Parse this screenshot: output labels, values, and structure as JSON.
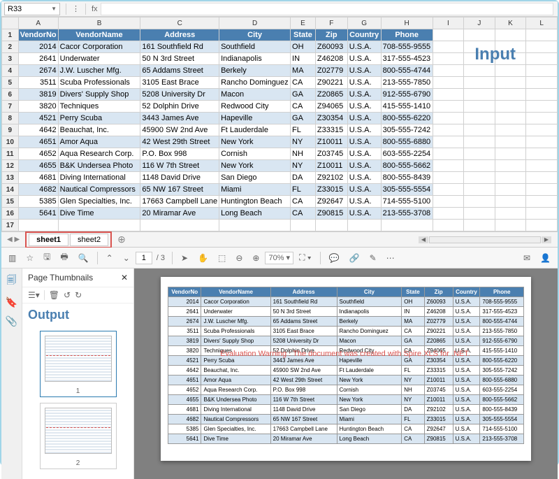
{
  "top": {
    "name_box": "R33",
    "fx_label": "fx",
    "input_label": "Input",
    "columns": [
      "A",
      "B",
      "C",
      "D",
      "E",
      "F",
      "G",
      "H",
      "I",
      "J",
      "K",
      "L"
    ],
    "headers": [
      "VendorNo",
      "VendorName",
      "Address",
      "City",
      "State",
      "Zip",
      "Country",
      "Phone"
    ],
    "rows": [
      {
        "n": "2",
        "v": [
          "2014",
          "Cacor Corporation",
          "161 Southfield Rd",
          "Southfield",
          "OH",
          "Z60093",
          "U.S.A.",
          "708-555-9555"
        ]
      },
      {
        "n": "3",
        "v": [
          "2641",
          "Underwater",
          "50 N 3rd Street",
          "Indianapolis",
          "IN",
          "Z46208",
          "U.S.A.",
          "317-555-4523"
        ]
      },
      {
        "n": "4",
        "v": [
          "2674",
          "J.W.  Luscher Mfg.",
          "65 Addams Street",
          "Berkely",
          "MA",
          "Z02779",
          "U.S.A.",
          "800-555-4744"
        ]
      },
      {
        "n": "5",
        "v": [
          "3511",
          "Scuba Professionals",
          "3105 East Brace",
          "Rancho Dominguez",
          "CA",
          "Z90221",
          "U.S.A.",
          "213-555-7850"
        ]
      },
      {
        "n": "6",
        "v": [
          "3819",
          "Divers'  Supply Shop",
          "5208 University Dr",
          "Macon",
          "GA",
          "Z20865",
          "U.S.A.",
          "912-555-6790"
        ]
      },
      {
        "n": "7",
        "v": [
          "3820",
          "Techniques",
          "52 Dolphin Drive",
          "Redwood City",
          "CA",
          "Z94065",
          "U.S.A.",
          "415-555-1410"
        ]
      },
      {
        "n": "8",
        "v": [
          "4521",
          "Perry Scuba",
          "3443 James Ave",
          "Hapeville",
          "GA",
          "Z30354",
          "U.S.A.",
          "800-555-6220"
        ]
      },
      {
        "n": "9",
        "v": [
          "4642",
          "Beauchat, Inc.",
          "45900 SW 2nd Ave",
          "Ft Lauderdale",
          "FL",
          "Z33315",
          "U.S.A.",
          "305-555-7242"
        ]
      },
      {
        "n": "10",
        "v": [
          "4651",
          "Amor Aqua",
          "42 West 29th Street",
          "New York",
          "NY",
          "Z10011",
          "U.S.A.",
          "800-555-6880"
        ]
      },
      {
        "n": "11",
        "v": [
          "4652",
          "Aqua Research Corp.",
          "P.O. Box 998",
          "Cornish",
          "NH",
          "Z03745",
          "U.S.A.",
          "603-555-2254"
        ]
      },
      {
        "n": "12",
        "v": [
          "4655",
          "B&K Undersea Photo",
          "116 W 7th Street",
          "New York",
          "NY",
          "Z10011",
          "U.S.A.",
          "800-555-5662"
        ]
      },
      {
        "n": "13",
        "v": [
          "4681",
          "Diving International",
          "1148 David Drive",
          "San Diego",
          "DA",
          "Z92102",
          "U.S.A.",
          "800-555-8439"
        ]
      },
      {
        "n": "14",
        "v": [
          "4682",
          "Nautical Compressors",
          "65 NW 167 Street",
          "Miami",
          "FL",
          "Z33015",
          "U.S.A.",
          "305-555-5554"
        ]
      },
      {
        "n": "15",
        "v": [
          "5385",
          "Glen Specialties, Inc.",
          "17663 Campbell Lane",
          "Huntington Beach",
          "CA",
          "Z92647",
          "U.S.A.",
          "714-555-5100"
        ]
      },
      {
        "n": "16",
        "v": [
          "5641",
          "Dive Time",
          "20 Miramar Ave",
          "Long Beach",
          "CA",
          "Z90815",
          "U.S.A.",
          "213-555-3708"
        ]
      }
    ],
    "empty_row": "17",
    "tabs": {
      "t1": "sheet1",
      "t2": "sheet2",
      "add": "⊕"
    }
  },
  "pdf": {
    "page_current": "1",
    "page_total": "/ 3",
    "zoom": "70% ▾",
    "thumb_title": "Page Thumbnails",
    "thumb_close": "✕",
    "output_label": "Output",
    "thumb_nums": {
      "p1": "1",
      "p2": "2"
    },
    "eval": "Evaluation Warning : The document was created with Spire.XLS for .NET.",
    "headers": [
      "VendorNo",
      "VendorName",
      "Address",
      "City",
      "State",
      "Zip",
      "Country",
      "Phone"
    ],
    "rows": [
      [
        "2014",
        "Cacor Corporation",
        "161 Southfield Rd",
        "Southfield",
        "OH",
        "Z60093",
        "U.S.A.",
        "708-555-9555"
      ],
      [
        "2641",
        "Underwater",
        "50 N 3rd Street",
        "Indianapolis",
        "IN",
        "Z46208",
        "U.S.A.",
        "317-555-4523"
      ],
      [
        "2674",
        "J.W.  Luscher Mfg.",
        "65 Addams Street",
        "Berkely",
        "MA",
        "Z02779",
        "U.S.A.",
        "800-555-4744"
      ],
      [
        "3511",
        "Scuba Professionals",
        "3105 East Brace",
        "Rancho Dominguez",
        "CA",
        "Z90221",
        "U.S.A.",
        "213-555-7850"
      ],
      [
        "3819",
        "Divers'  Supply Shop",
        "5208 University Dr",
        "Macon",
        "GA",
        "Z20865",
        "U.S.A.",
        "912-555-6790"
      ],
      [
        "3820",
        "Techniques",
        "52 Dolphin Drive",
        "Redwood City",
        "CA",
        "Z94065",
        "U.S.A.",
        "415-555-1410"
      ],
      [
        "4521",
        "Perry Scuba",
        "3443 James Ave",
        "Hapeville",
        "GA",
        "Z30354",
        "U.S.A.",
        "800-555-6220"
      ],
      [
        "4642",
        "Beauchat, Inc.",
        "45900 SW 2nd Ave",
        "Ft Lauderdale",
        "FL",
        "Z33315",
        "U.S.A.",
        "305-555-7242"
      ],
      [
        "4651",
        "Amor Aqua",
        "42 West 29th Street",
        "New York",
        "NY",
        "Z10011",
        "U.S.A.",
        "800-555-6880"
      ],
      [
        "4652",
        "Aqua Research Corp.",
        "P.O. Box 998",
        "Cornish",
        "NH",
        "Z03745",
        "U.S.A.",
        "603-555-2254"
      ],
      [
        "4655",
        "B&K Undersea Photo",
        "116 W 7th Street",
        "New York",
        "NY",
        "Z10011",
        "U.S.A.",
        "800-555-5662"
      ],
      [
        "4681",
        "Diving International",
        "1148 David Drive",
        "San Diego",
        "DA",
        "Z92102",
        "U.S.A.",
        "800-555-8439"
      ],
      [
        "4682",
        "Nautical Compressors",
        "65 NW 167 Street",
        "Miami",
        "FL",
        "Z33015",
        "U.S.A.",
        "305-555-5554"
      ],
      [
        "5385",
        "Glen Specialties, Inc.",
        "17663 Campbell Lane",
        "Huntington Beach",
        "CA",
        "Z92647",
        "U.S.A.",
        "714-555-5100"
      ],
      [
        "5641",
        "Dive Time",
        "20 Miramar Ave",
        "Long Beach",
        "CA",
        "Z90815",
        "U.S.A.",
        "213-555-3708"
      ]
    ]
  }
}
